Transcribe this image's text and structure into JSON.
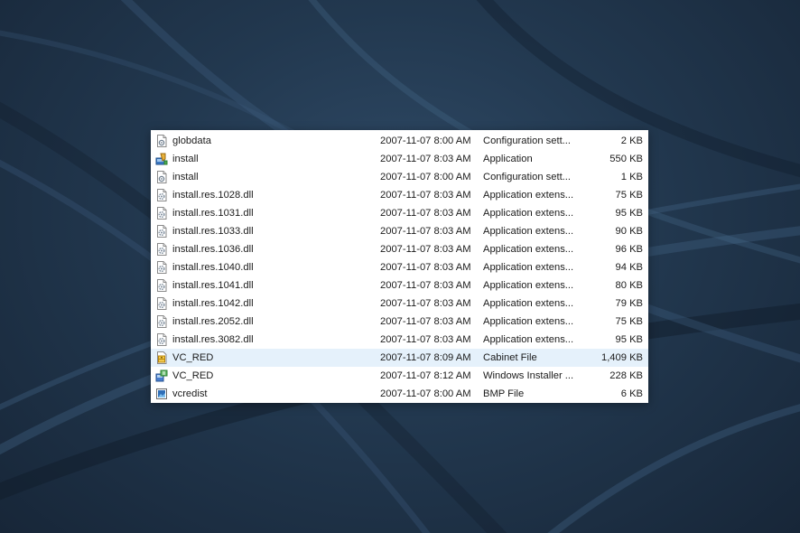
{
  "files": [
    {
      "name": "globdata",
      "date": "2007-11-07 8:00 AM",
      "type": "Configuration sett...",
      "size": "2 KB",
      "icon": "config-file-icon",
      "selected": false
    },
    {
      "name": "install",
      "date": "2007-11-07 8:03 AM",
      "type": "Application",
      "size": "550 KB",
      "icon": "installer-app-icon",
      "selected": false
    },
    {
      "name": "install",
      "date": "2007-11-07 8:00 AM",
      "type": "Configuration sett...",
      "size": "1 KB",
      "icon": "config-file-icon",
      "selected": false
    },
    {
      "name": "install.res.1028.dll",
      "date": "2007-11-07 8:03 AM",
      "type": "Application extens...",
      "size": "75 KB",
      "icon": "dll-file-icon",
      "selected": false
    },
    {
      "name": "install.res.1031.dll",
      "date": "2007-11-07 8:03 AM",
      "type": "Application extens...",
      "size": "95 KB",
      "icon": "dll-file-icon",
      "selected": false
    },
    {
      "name": "install.res.1033.dll",
      "date": "2007-11-07 8:03 AM",
      "type": "Application extens...",
      "size": "90 KB",
      "icon": "dll-file-icon",
      "selected": false
    },
    {
      "name": "install.res.1036.dll",
      "date": "2007-11-07 8:03 AM",
      "type": "Application extens...",
      "size": "96 KB",
      "icon": "dll-file-icon",
      "selected": false
    },
    {
      "name": "install.res.1040.dll",
      "date": "2007-11-07 8:03 AM",
      "type": "Application extens...",
      "size": "94 KB",
      "icon": "dll-file-icon",
      "selected": false
    },
    {
      "name": "install.res.1041.dll",
      "date": "2007-11-07 8:03 AM",
      "type": "Application extens...",
      "size": "80 KB",
      "icon": "dll-file-icon",
      "selected": false
    },
    {
      "name": "install.res.1042.dll",
      "date": "2007-11-07 8:03 AM",
      "type": "Application extens...",
      "size": "79 KB",
      "icon": "dll-file-icon",
      "selected": false
    },
    {
      "name": "install.res.2052.dll",
      "date": "2007-11-07 8:03 AM",
      "type": "Application extens...",
      "size": "75 KB",
      "icon": "dll-file-icon",
      "selected": false
    },
    {
      "name": "install.res.3082.dll",
      "date": "2007-11-07 8:03 AM",
      "type": "Application extens...",
      "size": "95 KB",
      "icon": "dll-file-icon",
      "selected": false
    },
    {
      "name": "VC_RED",
      "date": "2007-11-07 8:09 AM",
      "type": "Cabinet File",
      "size": "1,409 KB",
      "icon": "cabinet-file-icon",
      "selected": true
    },
    {
      "name": "VC_RED",
      "date": "2007-11-07 8:12 AM",
      "type": "Windows Installer ...",
      "size": "228 KB",
      "icon": "msi-package-icon",
      "selected": false
    },
    {
      "name": "vcredist",
      "date": "2007-11-07 8:00 AM",
      "type": "BMP File",
      "size": "6 KB",
      "icon": "bmp-image-icon",
      "selected": false
    }
  ],
  "colors": {
    "selection": "#e5f1fb",
    "wallpaper_dark": "#172638",
    "wallpaper_light": "#2f4a66"
  }
}
